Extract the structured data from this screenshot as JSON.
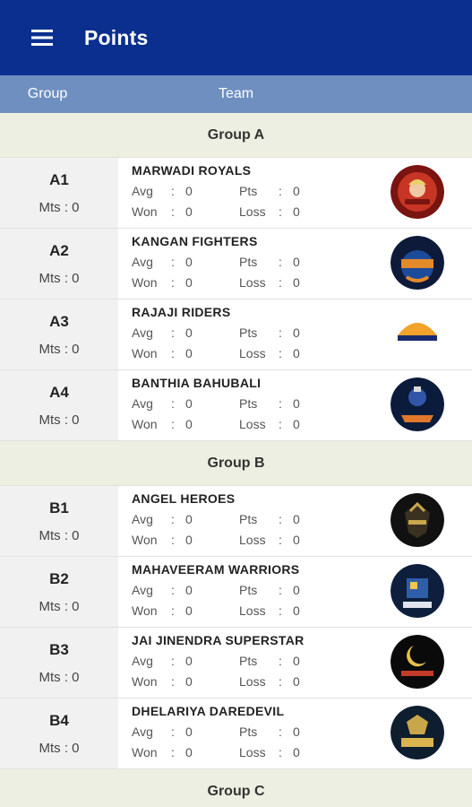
{
  "app": {
    "title": "Points",
    "menu_icon": "hamburger-menu-icon",
    "bar_color": "#0b2f8f"
  },
  "columns": {
    "group": "Group",
    "team": "Team"
  },
  "labels": {
    "avg": "Avg",
    "pts": "Pts",
    "won": "Won",
    "loss": "Loss",
    "sep": ":"
  },
  "groups": [
    {
      "title": "Group A",
      "teams": [
        {
          "code": "A1",
          "mts": "Mts : 0",
          "name": "MARWADI ROYALS",
          "avg": "0",
          "pts": "0",
          "won": "0",
          "loss": "0",
          "logo": "marwadi-royals-logo"
        },
        {
          "code": "A2",
          "mts": "Mts : 0",
          "name": "KANGAN FIGHTERS",
          "avg": "0",
          "pts": "0",
          "won": "0",
          "loss": "0",
          "logo": "kangan-fighters-logo"
        },
        {
          "code": "A3",
          "mts": "Mts : 0",
          "name": "RAJAJI RIDERS",
          "avg": "0",
          "pts": "0",
          "won": "0",
          "loss": "0",
          "logo": "rajaji-riders-logo"
        },
        {
          "code": "A4",
          "mts": "Mts : 0",
          "name": "BANTHIA BAHUBALI",
          "avg": "0",
          "pts": "0",
          "won": "0",
          "loss": "0",
          "logo": "banthia-bahubali-logo"
        }
      ]
    },
    {
      "title": "Group B",
      "teams": [
        {
          "code": "B1",
          "mts": "Mts : 0",
          "name": "ANGEL HEROES",
          "avg": "0",
          "pts": "0",
          "won": "0",
          "loss": "0",
          "logo": "angel-heroes-logo"
        },
        {
          "code": "B2",
          "mts": "Mts : 0",
          "name": "MAHAVEERAM WARRIORS",
          "avg": "0",
          "pts": "0",
          "won": "0",
          "loss": "0",
          "logo": "mahaveeram-warriors-logo"
        },
        {
          "code": "B3",
          "mts": "Mts : 0",
          "name": "JAI JINENDRA SUPERSTAR",
          "avg": "0",
          "pts": "0",
          "won": "0",
          "loss": "0",
          "logo": "jai-jinendra-superstar-logo"
        },
        {
          "code": "B4",
          "mts": "Mts : 0",
          "name": "DHELARIYA DAREDEVIL",
          "avg": "0",
          "pts": "0",
          "won": "0",
          "loss": "0",
          "logo": "dhelariya-daredevil-logo"
        }
      ]
    },
    {
      "title": "Group C",
      "teams": []
    }
  ]
}
